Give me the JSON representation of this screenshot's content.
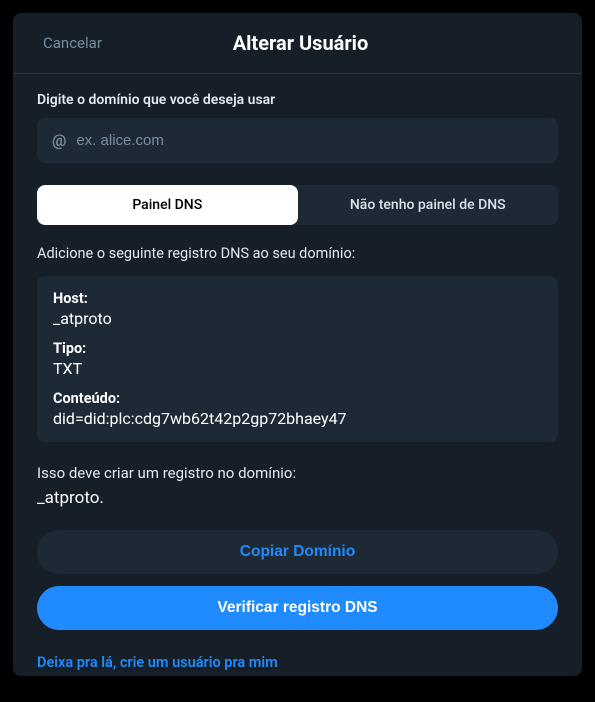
{
  "header": {
    "cancel": "Cancelar",
    "title": "Alterar Usuário"
  },
  "form": {
    "domainLabel": "Digite o domínio que você deseja usar",
    "placeholder": "ex. alice.com"
  },
  "tabs": {
    "panel": "Painel DNS",
    "noPanel": "Não tenho painel de DNS"
  },
  "instruction": "Adicione o seguinte registro DNS ao seu domínio:",
  "dns": {
    "hostLabel": "Host:",
    "hostValue": "_atproto",
    "typeLabel": "Tipo:",
    "typeValue": "TXT",
    "contentLabel": "Conteúdo:",
    "contentValue": "did=did:plc:cdg7wb62t42p2gp72bhaey47"
  },
  "result": {
    "text": "Isso deve criar um registro no domínio:",
    "domain": "_atproto."
  },
  "buttons": {
    "copy": "Copiar Domínio",
    "verify": "Verificar registro DNS"
  },
  "link": "Deixa pra lá, crie um usuário pra mim"
}
